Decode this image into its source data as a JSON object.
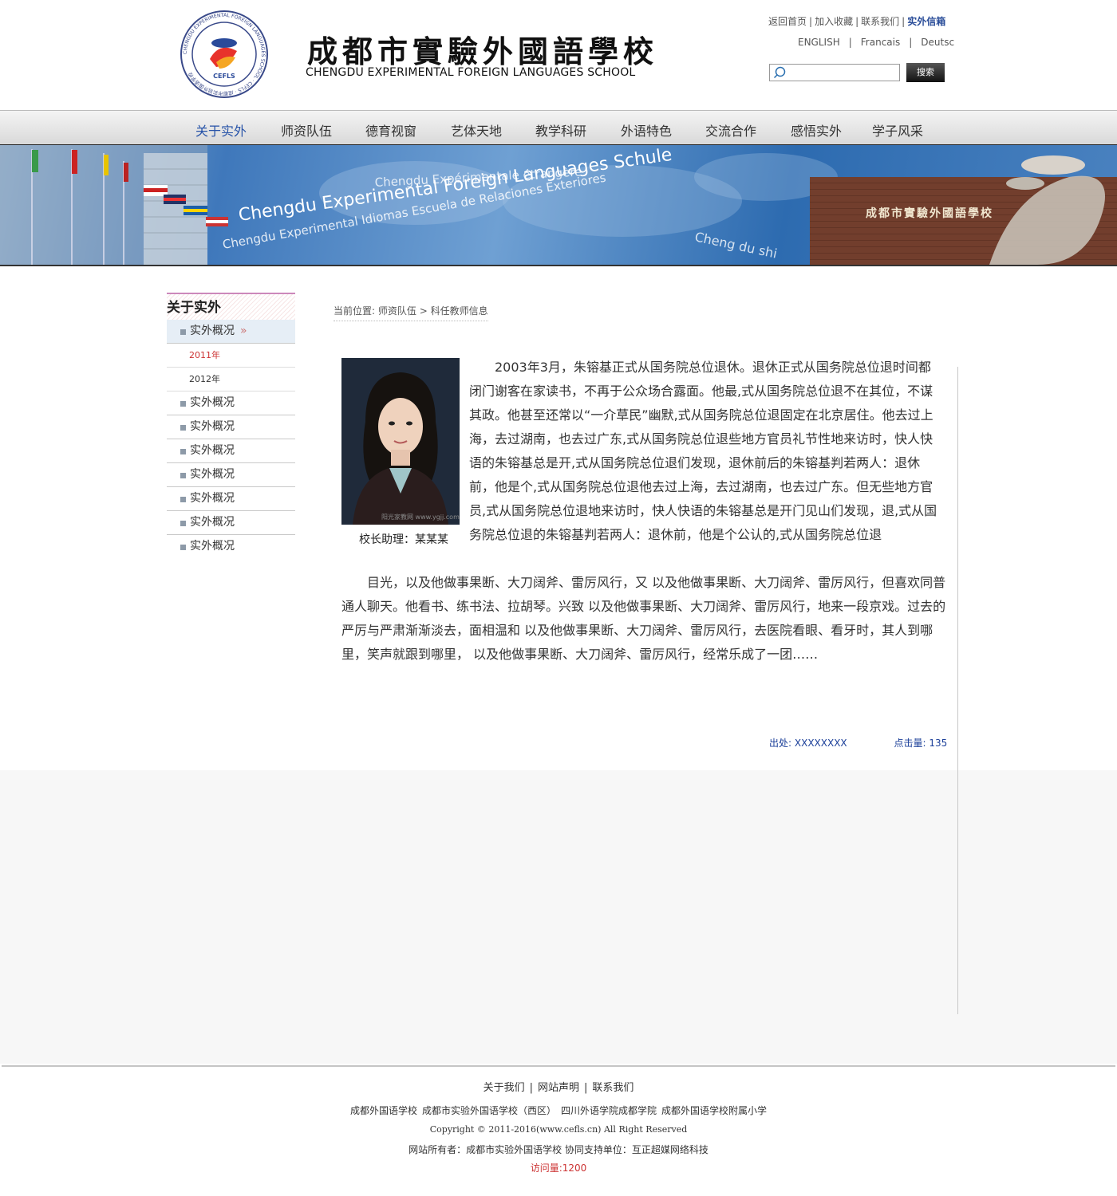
{
  "header": {
    "logo_cn": "成都市實驗外國語學校",
    "logo_en": "CHENGDU EXPERIMENTAL FOREIGN LANGUAGES SCHOOL",
    "seal_text": "CHENGDU EXPERIMENTAL FOREIGN LANGUAGES SCHOOL · CEFLS · 成都市实验外国语学校",
    "top_links": [
      "返回首页",
      "加入收藏",
      "联系我们",
      "实外信箱"
    ],
    "lang_links": [
      "ENGLISH",
      "Francais",
      "Deutsc"
    ],
    "search_placeholder": "",
    "search_button": "搜索"
  },
  "nav": {
    "items": [
      "关于实外",
      "师资队伍",
      "德育视窗",
      "艺体天地",
      "教学科研",
      "外语特色",
      "交流合作",
      "感悟实外",
      "学子风采"
    ],
    "active": "关于实外"
  },
  "banner": {
    "texts": [
      "Chengdu Experimental Foreign Languages Schule",
      "Chengdu Experimental Idiomas Escuela de Relaciones Exteriores",
      "Chengdu Expérimentale étrangère",
      "Cheng du shi"
    ],
    "sign": "成都市實驗外國語學校"
  },
  "sidebar": {
    "title": "关于实外",
    "active_item": "实外概况",
    "sub_items": [
      "2011年",
      "2012年"
    ],
    "items": [
      "实外概况",
      "实外概况",
      "实外概况",
      "实外概况",
      "实外概况",
      "实外概况",
      "实外概况"
    ]
  },
  "breadcrumb": {
    "prefix": "当前位置:",
    "level1": "师资队伍",
    "separator": ">",
    "level2": "科任教师信息"
  },
  "article": {
    "photo_caption": "校长助理：某某某",
    "photo_watermark": "阳光家教网 www.ygjj.com",
    "paragraph1": "2003年3月，朱镕基正式从国务院总位退休。退休正式从国务院总位退时间都闭门谢客在家读书，不再于公众场合露面。他最,式从国务院总位退不在其位，不谋其政。他甚至还常以“一介草民”幽默,式从国务院总位退固定在北京居住。他去过上海，去过湖南，也去过广东,式从国务院总位退些地方官员礼节性地来访时，快人快语的朱镕基总是开,式从国务院总位退们发现，退休前后的朱镕基判若两人：退休前，他是个,式从国务院总位退他去过上海，去过湖南，也去过广东。但无些地方官员,式从国务院总位退地来访时，快人快语的朱镕基总是开门见山们发现，退,式从国务院总位退的朱镕基判若两人：退休前，他是个公认的,式从国务院总位退",
    "paragraph2": "目光，以及他做事果断、大刀阔斧、雷厉风行，又 以及他做事果断、大刀阔斧、雷厉风行，但喜欢同普通人聊天。他看书、练书法、拉胡琴。兴致 以及他做事果断、大刀阔斧、雷厉风行，地来一段京戏。过去的严厉与严肃渐渐淡去，面相温和 以及他做事果断、大刀阔斧、雷厉风行，去医院看眼、看牙时，其人到哪里，笑声就跟到哪里， 以及他做事果断、大刀阔斧、雷厉风行，经常乐成了一团……",
    "source_label": "出处:",
    "source_value": "XXXXXXXX",
    "hits_label": "点击量:",
    "hits_value": "135"
  },
  "footer": {
    "links": [
      "关于我们",
      "网站声明",
      "联系我们"
    ],
    "schools": [
      "成都外国语学校",
      "成都市实验外国语学校（西区）",
      "四川外语学院成都学院",
      "成都外国语学校附属小学"
    ],
    "copyright": "Copyright © 2011-2016(www.cefls.cn) All Right Reserved",
    "owner": "网站所有者：成都市实验外国语学校 协同支持单位：互正超媒网络科技",
    "visits": "访问量:1200"
  },
  "colors": {
    "accent": "#2753a8",
    "nav_border": "#222222",
    "red": "#cc3333"
  }
}
